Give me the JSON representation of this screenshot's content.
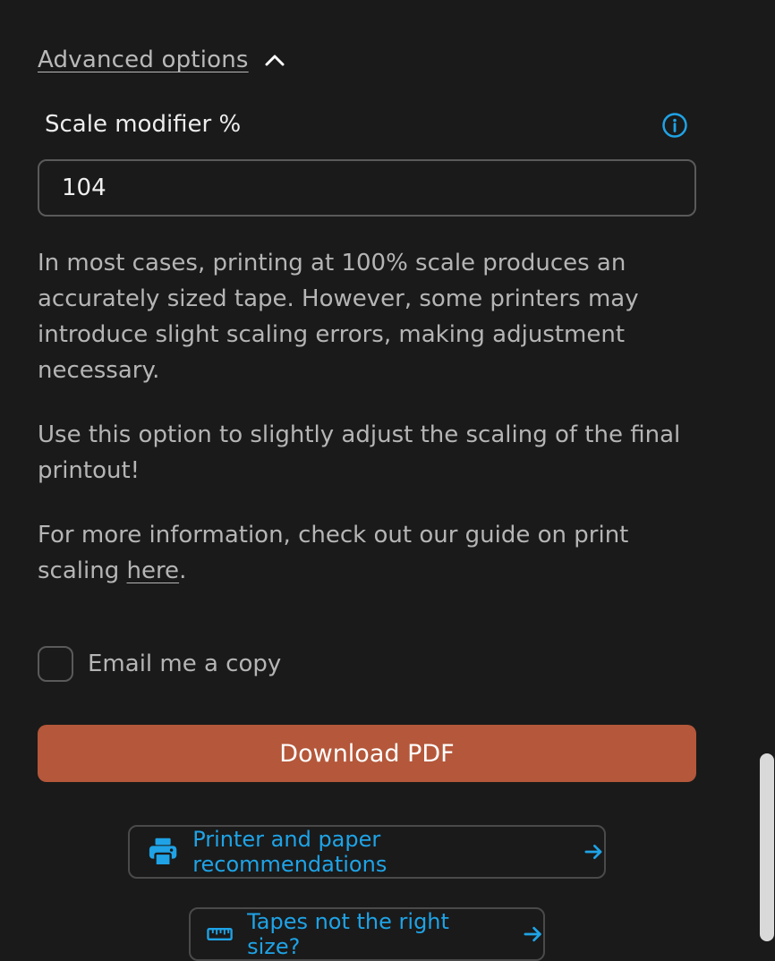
{
  "advanced": {
    "label": "Advanced options",
    "icon": "chevron-up-icon"
  },
  "scale": {
    "label": "Scale modifier %",
    "value": "104",
    "info_icon": "info-icon"
  },
  "description": {
    "para1": "In most cases, printing at 100% scale produces an accurately sized tape. However, some printers may introduce slight scaling errors, making adjustment necessary.",
    "para2": "Use this option to slightly adjust the scaling of the final printout!",
    "para3_text": "For more information, check out our guide on print scaling ",
    "para3_link": "here",
    "para3_end": "."
  },
  "email": {
    "label": "Email me a copy",
    "checked": false
  },
  "download": {
    "label": "Download PDF"
  },
  "links": {
    "printer": {
      "label": "Printer and paper recommendations",
      "icon": "printer-icon"
    },
    "tapes": {
      "label": "Tapes not the right size?",
      "icon": "ruler-icon"
    }
  },
  "colors": {
    "background": "#1a1a1a",
    "accent": "#1fa3e6",
    "download_button": "#b4573a"
  }
}
